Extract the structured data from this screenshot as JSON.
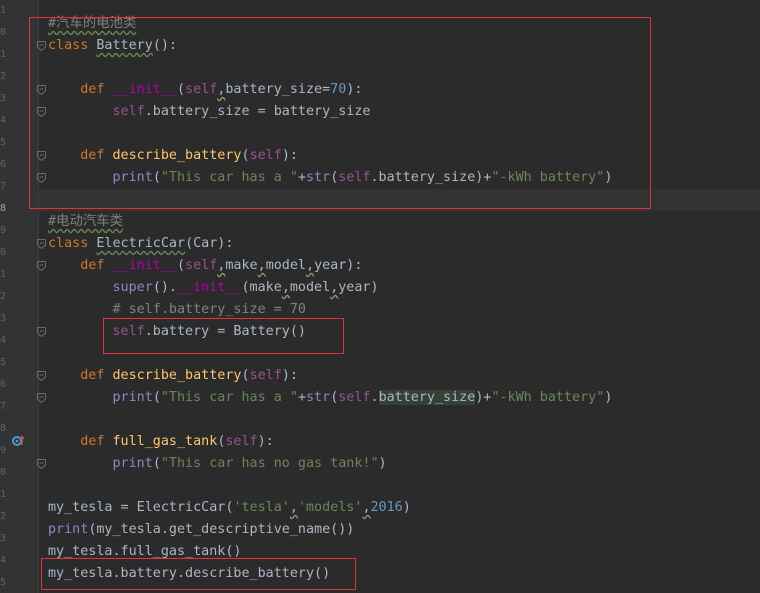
{
  "editor": {
    "line_numbers": [
      "1",
      "0",
      "1",
      "2",
      "3",
      "4",
      "5",
      "6",
      "7",
      "8",
      "9",
      "0",
      "1",
      "2",
      "3",
      "4",
      "5",
      "6",
      "7",
      "8",
      "9",
      "0",
      "1",
      "2",
      "3",
      "4",
      "5"
    ],
    "lines": [
      {
        "parts": [
          {
            "t": "#汽车的电池类",
            "c": "cm-cn squig"
          }
        ]
      },
      {
        "parts": [
          {
            "t": "class ",
            "c": "kw"
          },
          {
            "t": "Battery",
            "c": "squig"
          },
          {
            "t": "():",
            "c": ""
          }
        ]
      },
      {
        "parts": []
      },
      {
        "parts": [
          {
            "t": "    "
          },
          {
            "t": "def ",
            "c": "kw"
          },
          {
            "t": "__init__",
            "c": "magic"
          },
          {
            "t": "("
          },
          {
            "t": "self",
            "c": "self"
          },
          {
            "t": ",",
            "c": "paramsq"
          },
          {
            "t": "battery_size",
            "c": ""
          },
          {
            "t": "="
          },
          {
            "t": "70",
            "c": "num"
          },
          {
            "t": "):"
          }
        ]
      },
      {
        "parts": [
          {
            "t": "        "
          },
          {
            "t": "self",
            "c": "self"
          },
          {
            "t": ".battery_size = battery_size"
          }
        ]
      },
      {
        "parts": []
      },
      {
        "parts": [
          {
            "t": "    "
          },
          {
            "t": "def ",
            "c": "kw"
          },
          {
            "t": "describe_battery",
            "c": "fn"
          },
          {
            "t": "("
          },
          {
            "t": "self",
            "c": "self"
          },
          {
            "t": "):"
          }
        ]
      },
      {
        "parts": [
          {
            "t": "        "
          },
          {
            "t": "print",
            "c": "builtin"
          },
          {
            "t": "("
          },
          {
            "t": "\"This car has a \"",
            "c": "str"
          },
          {
            "t": "+"
          },
          {
            "t": "str",
            "c": "builtin"
          },
          {
            "t": "("
          },
          {
            "t": "self",
            "c": "self"
          },
          {
            "t": ".battery_size)+"
          },
          {
            "t": "\"-kWh battery\"",
            "c": "str"
          },
          {
            "t": ")"
          }
        ]
      },
      {
        "parts": []
      },
      {
        "parts": [
          {
            "t": "#电动汽车类",
            "c": "cm-cn squig"
          }
        ]
      },
      {
        "parts": [
          {
            "t": "class ",
            "c": "kw"
          },
          {
            "t": "ElectricCar",
            "c": "squig"
          },
          {
            "t": "(Car):"
          }
        ]
      },
      {
        "parts": [
          {
            "t": "    "
          },
          {
            "t": "def ",
            "c": "kw"
          },
          {
            "t": "__init__",
            "c": "magic"
          },
          {
            "t": "("
          },
          {
            "t": "self",
            "c": "self"
          },
          {
            "t": ",",
            "c": "paramsq"
          },
          {
            "t": "make"
          },
          {
            "t": ",",
            "c": "paramsq"
          },
          {
            "t": "model"
          },
          {
            "t": ",",
            "c": "paramsq"
          },
          {
            "t": "year):"
          }
        ]
      },
      {
        "parts": [
          {
            "t": "        "
          },
          {
            "t": "super",
            "c": "builtin"
          },
          {
            "t": "()."
          },
          {
            "t": "__init__",
            "c": "magic"
          },
          {
            "t": "(make"
          },
          {
            "t": ",",
            "c": "paramsq"
          },
          {
            "t": "model"
          },
          {
            "t": ",",
            "c": "paramsq"
          },
          {
            "t": "year)"
          }
        ]
      },
      {
        "parts": [
          {
            "t": "        "
          },
          {
            "t": "# self.battery_size = 70",
            "c": "cm"
          }
        ]
      },
      {
        "parts": [
          {
            "t": "        "
          },
          {
            "t": "self",
            "c": "self"
          },
          {
            "t": ".battery = Battery()"
          }
        ]
      },
      {
        "parts": []
      },
      {
        "parts": [
          {
            "t": "    "
          },
          {
            "t": "def ",
            "c": "kw"
          },
          {
            "t": "describe_battery",
            "c": "fn"
          },
          {
            "t": "("
          },
          {
            "t": "self",
            "c": "self"
          },
          {
            "t": "):"
          }
        ]
      },
      {
        "parts": [
          {
            "t": "        "
          },
          {
            "t": "print",
            "c": "builtin"
          },
          {
            "t": "("
          },
          {
            "t": "\"This car has a \"",
            "c": "str"
          },
          {
            "t": "+"
          },
          {
            "t": "str",
            "c": "builtin"
          },
          {
            "t": "("
          },
          {
            "t": "self",
            "c": "self"
          },
          {
            "t": "."
          },
          {
            "t": "battery_size",
            "c": "hl"
          },
          {
            "t": ")+"
          },
          {
            "t": "\"-kWh battery\"",
            "c": "str"
          },
          {
            "t": ")"
          }
        ]
      },
      {
        "parts": []
      },
      {
        "parts": [
          {
            "t": "    "
          },
          {
            "t": "def ",
            "c": "kw"
          },
          {
            "t": "full_gas_tank",
            "c": "fn"
          },
          {
            "t": "("
          },
          {
            "t": "self",
            "c": "self"
          },
          {
            "t": "):"
          }
        ]
      },
      {
        "parts": [
          {
            "t": "        "
          },
          {
            "t": "print",
            "c": "builtin"
          },
          {
            "t": "("
          },
          {
            "t": "\"This car has no gas tank!\"",
            "c": "str"
          },
          {
            "t": ")"
          }
        ]
      },
      {
        "parts": []
      },
      {
        "parts": [
          {
            "t": "my_tesla = ElectricCar("
          },
          {
            "t": "'tesla'",
            "c": "str"
          },
          {
            "t": ",",
            "c": "paramsq"
          },
          {
            "t": "'models'",
            "c": "str"
          },
          {
            "t": ",",
            "c": "paramsq"
          },
          {
            "t": "2016",
            "c": "num"
          },
          {
            "t": ")"
          }
        ]
      },
      {
        "parts": [
          {
            "t": "print",
            "c": "builtin"
          },
          {
            "t": "(my_tesla.get_descriptive_name())"
          }
        ]
      },
      {
        "parts": [
          {
            "t": "my_tesla.full_gas_tank()"
          }
        ]
      },
      {
        "parts": [
          {
            "t": "my_tesla.battery.describe_battery()"
          }
        ]
      }
    ],
    "caret_line_index": 8,
    "highlight_box_color": "#e0323f"
  }
}
